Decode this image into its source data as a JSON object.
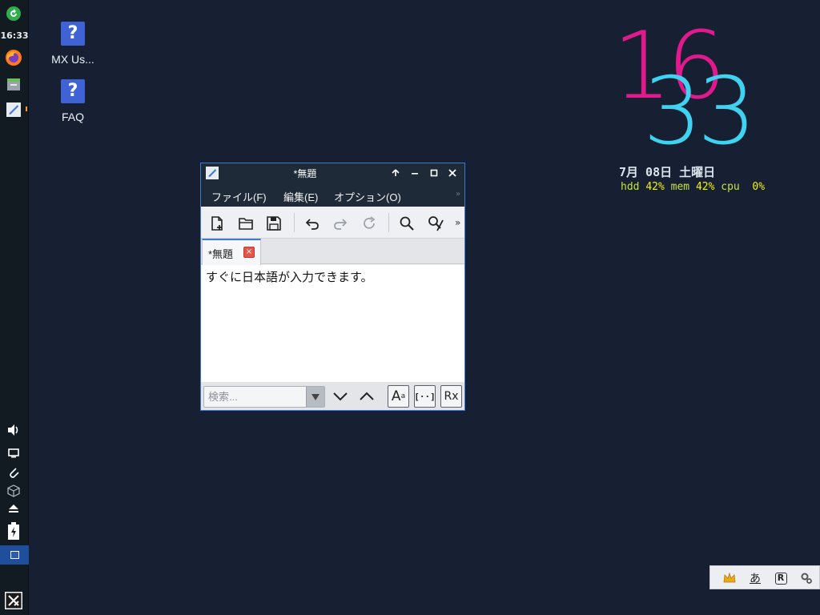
{
  "panel": {
    "clock": "16:33",
    "icons": [
      "refresh-update-icon",
      "firefox-icon",
      "file-manager-icon",
      "text-editor-icon",
      "volume-icon",
      "display-icon",
      "clipboard-icon",
      "package-icon",
      "eject-icon",
      "battery-icon",
      "workspace-pager-icon",
      "mx-menu-icon"
    ],
    "indicator_color": "#f0a030"
  },
  "desktop": {
    "icons": [
      {
        "label": "MX Us...",
        "glyph": "?"
      },
      {
        "label": "FAQ",
        "glyph": "?"
      }
    ],
    "background": "#162032"
  },
  "conky": {
    "hour": "16",
    "minute": "33",
    "date": "7月 08日 土曜日",
    "hdd_label": "hdd",
    "hdd_value": "42%",
    "mem_label": "mem",
    "mem_value": "42%",
    "cpu_label": "cpu",
    "cpu_value": "0%",
    "hour_color": "#e01a8c",
    "minute_color": "#3fd3f1"
  },
  "editor": {
    "title": "*無題",
    "menu": [
      "ファイル(F)",
      "編集(E)",
      "オプション(O)"
    ],
    "menu_more": "»",
    "toolbar": [
      "new-file-icon",
      "open-folder-icon",
      "save-icon",
      "undo-icon",
      "redo-icon",
      "reload-icon",
      "search-icon",
      "replace-icon"
    ],
    "toolbar_more": "»",
    "tab": {
      "label": "*無題",
      "close": "×"
    },
    "content": "すぐに日本語が入力できます。",
    "search": {
      "placeholder": "検索...",
      "match_case": "A",
      "whole_word": "[··]",
      "regex": "Rx"
    },
    "accent": "#3d7ad4"
  },
  "tray": {
    "ime": "あ",
    "r": "R",
    "icons": [
      "crown-icon",
      "hiragana-icon",
      "r-icon",
      "settings-icon"
    ]
  }
}
